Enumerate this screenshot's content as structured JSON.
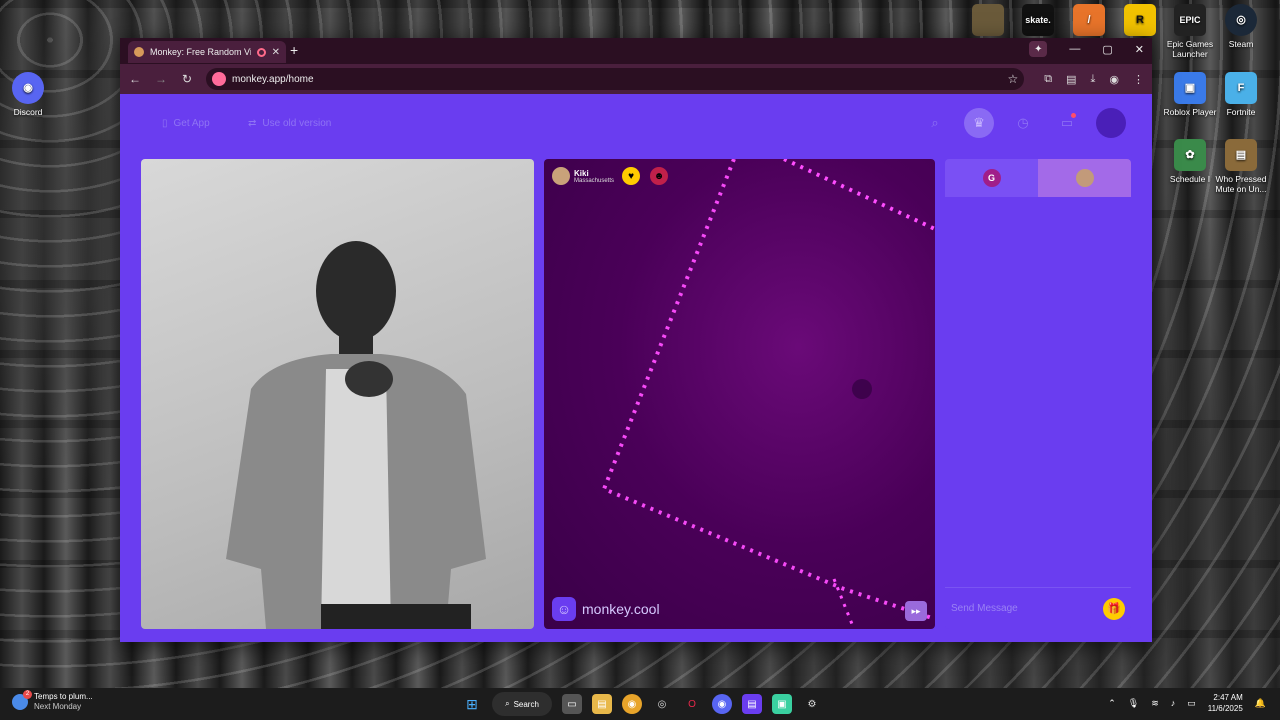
{
  "desktop": {
    "left_icons": [
      {
        "label": "Discord",
        "color": "#5865f2",
        "glyph": "◉"
      }
    ],
    "right_icons": [
      {
        "label": "",
        "color": "#6a5a3a",
        "glyph": ""
      },
      {
        "label": "skate.",
        "color": "#111111",
        "glyph": "skate."
      },
      {
        "label": "",
        "color": "#e8742a",
        "glyph": "/"
      },
      {
        "label": "",
        "color": "#f2c200",
        "glyph": "R"
      },
      {
        "label": "Epic Games Launcher",
        "color": "#222222",
        "glyph": "EPIC"
      },
      {
        "label": "Steam",
        "color": "#1b2838",
        "glyph": "◎"
      },
      {
        "label": "Roblox Player",
        "color": "#3a7ae8",
        "glyph": "▣"
      },
      {
        "label": "Fortnite",
        "color": "#4ab0e8",
        "glyph": "F"
      },
      {
        "label": "Schedule I",
        "color": "#3a8a4a",
        "glyph": "✿"
      },
      {
        "label": "Who Pressed Mute on Un...",
        "color": "#8a6a3a",
        "glyph": "▤"
      }
    ]
  },
  "browser": {
    "tab_title": "Monkey: Free Random Vide",
    "url": "monkey.app/home"
  },
  "page": {
    "header": {
      "get_app": "Get App",
      "use_old_version": "Use old version"
    },
    "video_remote": {
      "user_name": "Kiki",
      "user_location": "Massachusetts",
      "brand": "monkey.cool"
    },
    "chat": {
      "tab_initial": "G",
      "placeholder": "Send Message"
    }
  },
  "taskbar": {
    "weather_title": "Temps to plum...",
    "weather_sub": "Next Monday",
    "search_label": "Search",
    "time": "2:47 AM",
    "date": "11/6/2025"
  }
}
